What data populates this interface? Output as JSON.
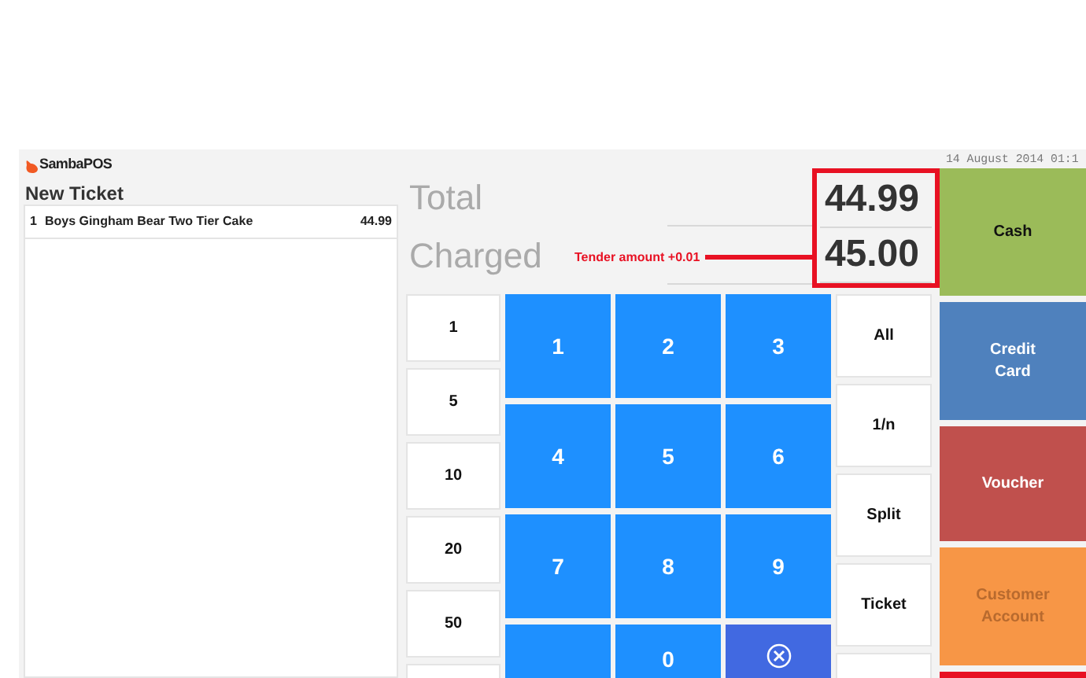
{
  "app": {
    "logo": "SambaPOS",
    "date": "14 August 2014 01:1"
  },
  "ticket": {
    "title": "New Ticket",
    "items": [
      {
        "quantity": "1",
        "name": "Boys Gingham Bear Two Tier Cake",
        "price": "44.99"
      }
    ]
  },
  "totals": [
    {
      "label": "Total",
      "value": "44.99"
    },
    {
      "label": "Charged",
      "value": "45.00",
      "annotation": "Tender amount +0.01"
    }
  ],
  "quick_amounts": [
    "1",
    "5",
    "10",
    "20",
    "50"
  ],
  "keys": [
    {
      "kind": "digit",
      "label": "1"
    },
    {
      "kind": "digit",
      "label": "2"
    },
    {
      "kind": "digit",
      "label": "3"
    },
    {
      "kind": "digit",
      "label": "4"
    },
    {
      "kind": "digit",
      "label": "5"
    },
    {
      "kind": "digit",
      "label": "6"
    },
    {
      "kind": "digit",
      "label": "7"
    },
    {
      "kind": "digit",
      "label": "8"
    },
    {
      "kind": "digit",
      "label": "9"
    },
    {
      "kind": "blank"
    },
    {
      "kind": "digit",
      "label": "0"
    },
    {
      "kind": "clear"
    }
  ],
  "actions": [
    "All",
    "1/n",
    "Split",
    "Ticket"
  ],
  "payments": [
    {
      "label": "Cash",
      "color": "#9bbb59",
      "disabled": false
    },
    {
      "label": "Credit Card",
      "color": "#4f81bd",
      "disabled": false
    },
    {
      "label": "Voucher",
      "color": "#c0504d",
      "disabled": false
    },
    {
      "label": "Customer Account",
      "color": "#f79646",
      "disabled": true
    },
    {
      "color": "#e81123"
    }
  ]
}
